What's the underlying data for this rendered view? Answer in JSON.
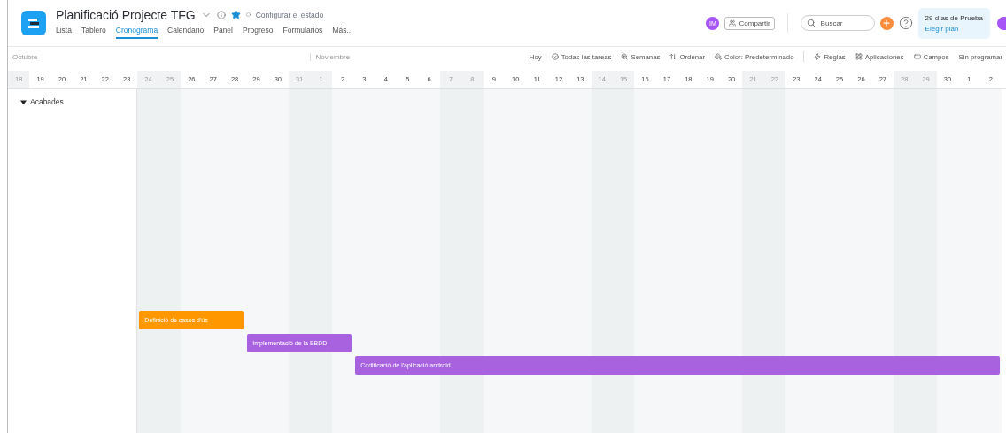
{
  "project": {
    "title": "Planificació Projecte TFG",
    "favorite": true,
    "status": "Configurar el estado"
  },
  "tabs": [
    {
      "label": "Lista",
      "selected": false
    },
    {
      "label": "Tablero",
      "selected": false
    },
    {
      "label": "Cronograma",
      "selected": true
    },
    {
      "label": "Calendario",
      "selected": false
    },
    {
      "label": "Panel",
      "selected": false
    },
    {
      "label": "Progreso",
      "selected": false
    },
    {
      "label": "Formularios",
      "selected": false
    },
    {
      "label": "Más...",
      "selected": false
    }
  ],
  "header": {
    "avatar": "IM",
    "share": "Compartir",
    "search": {
      "placeholder": "Buscar"
    },
    "trial": {
      "days": "29 días de Prueba",
      "link": "Elegir plan"
    }
  },
  "toolbar": {
    "view": [
      {
        "label": "Hoy",
        "kind": "plain"
      },
      {
        "label": "Todas las tareas",
        "kind": "check"
      },
      {
        "label": "Semanas",
        "kind": "zoom"
      },
      {
        "label": "Ordenar",
        "kind": "sort"
      },
      {
        "label": "Color: Predeterminado",
        "kind": "paint"
      }
    ],
    "tools": [
      {
        "label": "Reglas",
        "kind": "zap"
      },
      {
        "label": "Aplicaciones",
        "kind": "apps"
      },
      {
        "label": "Campos",
        "kind": "fields"
      },
      {
        "label": "Sin programar",
        "kind": "plain"
      }
    ]
  },
  "months": [
    {
      "name": "Octubre",
      "days": [
        {
          "day": "18",
          "weekend": true
        },
        {
          "day": "19",
          "weekend": false
        },
        {
          "day": "20",
          "weekend": false
        },
        {
          "day": "21",
          "weekend": false
        },
        {
          "day": "22",
          "weekend": false
        },
        {
          "day": "23",
          "weekend": false
        },
        {
          "day": "24",
          "weekend": true
        },
        {
          "day": "25",
          "weekend": true
        },
        {
          "day": "26",
          "weekend": false
        },
        {
          "day": "27",
          "weekend": false
        },
        {
          "day": "28",
          "weekend": false
        },
        {
          "day": "29",
          "weekend": false
        },
        {
          "day": "30",
          "weekend": false
        },
        {
          "day": "31",
          "weekend": true
        }
      ]
    },
    {
      "name": "Noviembre",
      "days": [
        {
          "day": "1",
          "weekend": true
        },
        {
          "day": "2",
          "weekend": false
        },
        {
          "day": "3",
          "weekend": false
        },
        {
          "day": "4",
          "weekend": false
        },
        {
          "day": "5",
          "weekend": false
        },
        {
          "day": "6",
          "weekend": false
        },
        {
          "day": "7",
          "weekend": true
        },
        {
          "day": "8",
          "weekend": true
        },
        {
          "day": "9",
          "weekend": false
        },
        {
          "day": "10",
          "weekend": false
        },
        {
          "day": "11",
          "weekend": false
        },
        {
          "day": "12",
          "weekend": false
        },
        {
          "day": "13",
          "weekend": false
        },
        {
          "day": "14",
          "weekend": true
        },
        {
          "day": "15",
          "weekend": true
        },
        {
          "day": "16",
          "weekend": false
        },
        {
          "day": "17",
          "weekend": false
        },
        {
          "day": "18",
          "weekend": false
        },
        {
          "day": "19",
          "weekend": false
        },
        {
          "day": "20",
          "weekend": false
        },
        {
          "day": "21",
          "weekend": true
        },
        {
          "day": "22",
          "weekend": true
        },
        {
          "day": "23",
          "weekend": false
        },
        {
          "day": "24",
          "weekend": false
        },
        {
          "day": "25",
          "weekend": false
        },
        {
          "day": "26",
          "weekend": false
        },
        {
          "day": "27",
          "weekend": false
        },
        {
          "day": "28",
          "weekend": true
        },
        {
          "day": "29",
          "weekend": true
        },
        {
          "day": "30",
          "weekend": false
        }
      ]
    },
    {
      "days": [
        {
          "day": "1",
          "weekend": false
        },
        {
          "day": "2",
          "weekend": false
        }
      ]
    }
  ],
  "group": {
    "name": "Acabades",
    "expanded": true
  },
  "tasks": [
    {
      "name": "Definició de casos d'ús",
      "color": "#ff9800"
    },
    {
      "name": "Implementació de la BBDD",
      "color": "#a862e0"
    },
    {
      "name": "Codificació de l'aplicació android",
      "color": "#a862e0"
    }
  ]
}
